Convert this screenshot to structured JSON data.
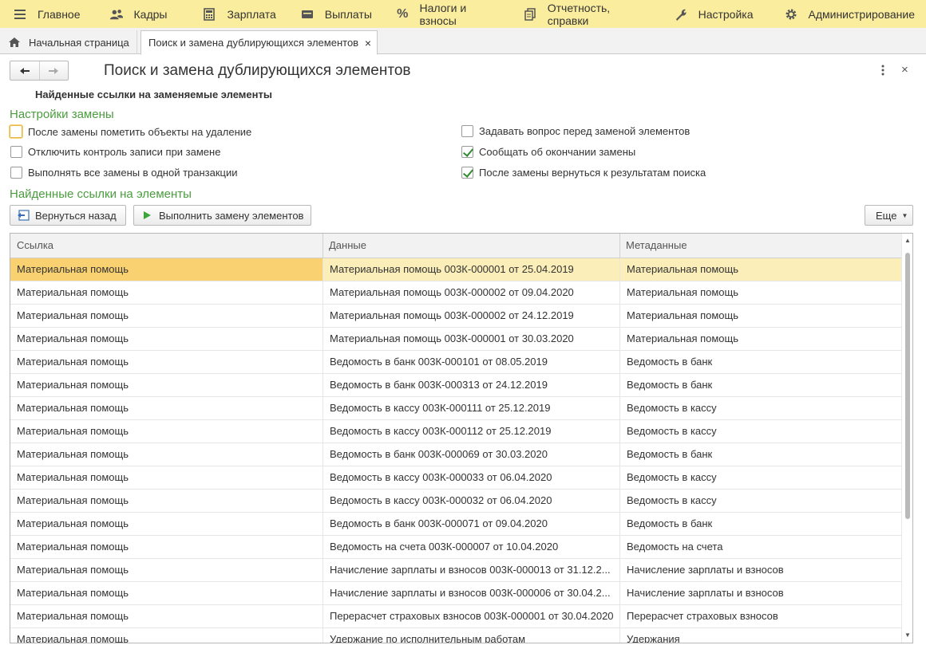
{
  "menu": [
    {
      "label": "Главное",
      "icon": "hamburger-icon"
    },
    {
      "label": "Кадры",
      "icon": "people-icon"
    },
    {
      "label": "Зарплата",
      "icon": "calculator-icon"
    },
    {
      "label": "Выплаты",
      "icon": "wallet-icon"
    },
    {
      "label": "Налоги и взносы",
      "icon": "percent-icon"
    },
    {
      "label": "Отчетность, справки",
      "icon": "documents-icon"
    },
    {
      "label": "Настройка",
      "icon": "wrench-icon"
    },
    {
      "label": "Администрирование",
      "icon": "gear-icon"
    }
  ],
  "tabs": {
    "home_label": "Начальная страница",
    "active_label": "Поиск и замена дублирующихся элементов",
    "close_glyph": "×"
  },
  "form": {
    "title": "Поиск и замена дублирующихся элементов",
    "subheading": "Найденные ссылки на заменяемые элементы",
    "close_glyph": "×",
    "settings_title": "Настройки замены",
    "refs_title": "Найденные ссылки на элементы"
  },
  "options_left": [
    {
      "label": "После замены пометить объекты на удаление",
      "checked": false
    },
    {
      "label": "Отключить контроль записи при замене",
      "checked": false
    },
    {
      "label": "Выполнять все замены в одной транзакции",
      "checked": false
    }
  ],
  "options_right": [
    {
      "label": "Задавать вопрос перед заменой элементов",
      "checked": false
    },
    {
      "label": "Сообщать об окончании замены",
      "checked": true
    },
    {
      "label": "После замены вернуться к результатам поиска",
      "checked": true
    }
  ],
  "buttons": {
    "back": "Вернуться назад",
    "execute": "Выполнить замену элементов",
    "more": "Еще"
  },
  "table": {
    "columns": [
      "Ссылка",
      "Данные",
      "Метаданные"
    ],
    "rows": [
      [
        "Материальная помощь",
        "Материальная помощь 003К-000001 от 25.04.2019",
        "Материальная помощь"
      ],
      [
        "Материальная помощь",
        "Материальная помощь 003К-000002 от 09.04.2020",
        "Материальная помощь"
      ],
      [
        "Материальная помощь",
        "Материальная помощь 003К-000002 от 24.12.2019",
        "Материальная помощь"
      ],
      [
        "Материальная помощь",
        "Материальная помощь 003К-000001 от 30.03.2020",
        "Материальная помощь"
      ],
      [
        "Материальная помощь",
        "Ведомость в банк 003К-000101 от 08.05.2019",
        "Ведомость в банк"
      ],
      [
        "Материальная помощь",
        "Ведомость в банк 003К-000313 от 24.12.2019",
        "Ведомость в банк"
      ],
      [
        "Материальная помощь",
        "Ведомость в кассу 003К-000111 от 25.12.2019",
        "Ведомость в кассу"
      ],
      [
        "Материальная помощь",
        "Ведомость в кассу 003К-000112 от 25.12.2019",
        "Ведомость в кассу"
      ],
      [
        "Материальная помощь",
        "Ведомость в банк 003К-000069 от 30.03.2020",
        "Ведомость в банк"
      ],
      [
        "Материальная помощь",
        "Ведомость в кассу 003К-000033 от 06.04.2020",
        "Ведомость в кассу"
      ],
      [
        "Материальная помощь",
        "Ведомость в кассу 003К-000032 от 06.04.2020",
        "Ведомость в кассу"
      ],
      [
        "Материальная помощь",
        "Ведомость в банк 003К-000071 от 09.04.2020",
        "Ведомость в банк"
      ],
      [
        "Материальная помощь",
        "Ведомость на счета 003К-000007 от 10.04.2020",
        "Ведомость на счета"
      ],
      [
        "Материальная помощь",
        "Начисление зарплаты и взносов 003К-000013 от 31.12.2...",
        "Начисление зарплаты и взносов"
      ],
      [
        "Материальная помощь",
        "Начисление зарплаты и взносов 003К-000006 от 30.04.2...",
        "Начисление зарплаты и взносов"
      ],
      [
        "Материальная помощь",
        "Перерасчет страховых взносов 003К-000001 от 30.04.2020",
        "Перерасчет страховых взносов"
      ],
      [
        "Материальная помощь",
        "Удержание по исполнительным работам",
        "Удержания"
      ]
    ]
  },
  "colors": {
    "menubar": "#fbed9e",
    "group_title": "#4b9c3f",
    "selected_row": "#fbeeb9",
    "selected_cell": "#f9d170"
  }
}
